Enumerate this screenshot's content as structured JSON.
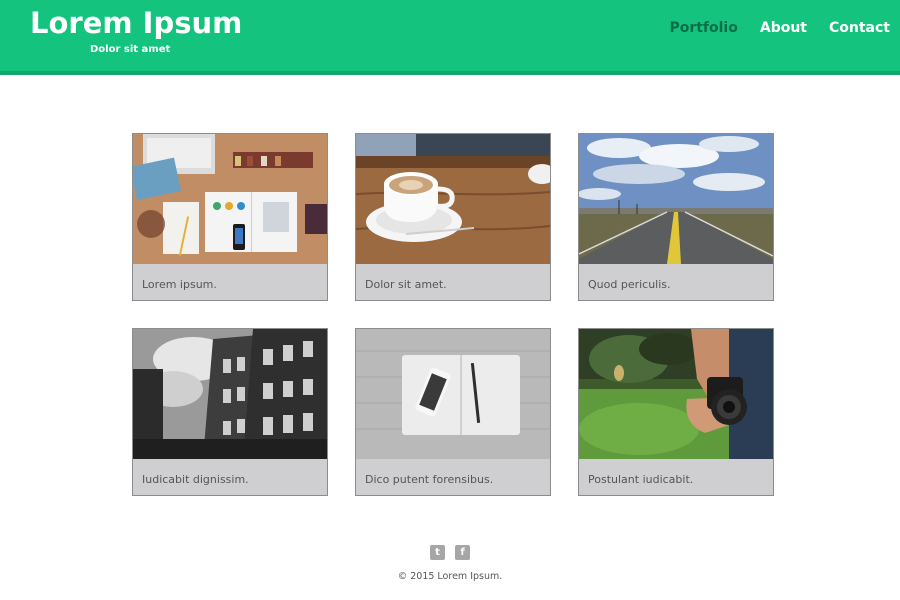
{
  "header": {
    "title": "Lorem Ipsum",
    "subtitle": "Dolor sit amet",
    "brand_color": "#14c47e",
    "nav": [
      {
        "label": "Portfolio",
        "active": true
      },
      {
        "label": "About",
        "active": false
      },
      {
        "label": "Contact",
        "active": false
      }
    ]
  },
  "portfolio": {
    "items": [
      {
        "caption": "Lorem ipsum.",
        "image": "desk-workspace-photo"
      },
      {
        "caption": "Dolor sit amet.",
        "image": "coffee-cup-photo"
      },
      {
        "caption": "Quod periculis.",
        "image": "open-road-photo"
      },
      {
        "caption": "Iudicabit dignissim.",
        "image": "brick-building-photo"
      },
      {
        "caption": "Dico putent forensibus.",
        "image": "notebook-phone-photo"
      },
      {
        "caption": "Postulant iudicabit.",
        "image": "camera-hand-photo"
      }
    ]
  },
  "footer": {
    "social": [
      {
        "icon": "twitter-icon",
        "glyph": "t"
      },
      {
        "icon": "facebook-icon",
        "glyph": "f"
      }
    ],
    "copyright": "© 2015 Lorem Ipsum."
  }
}
